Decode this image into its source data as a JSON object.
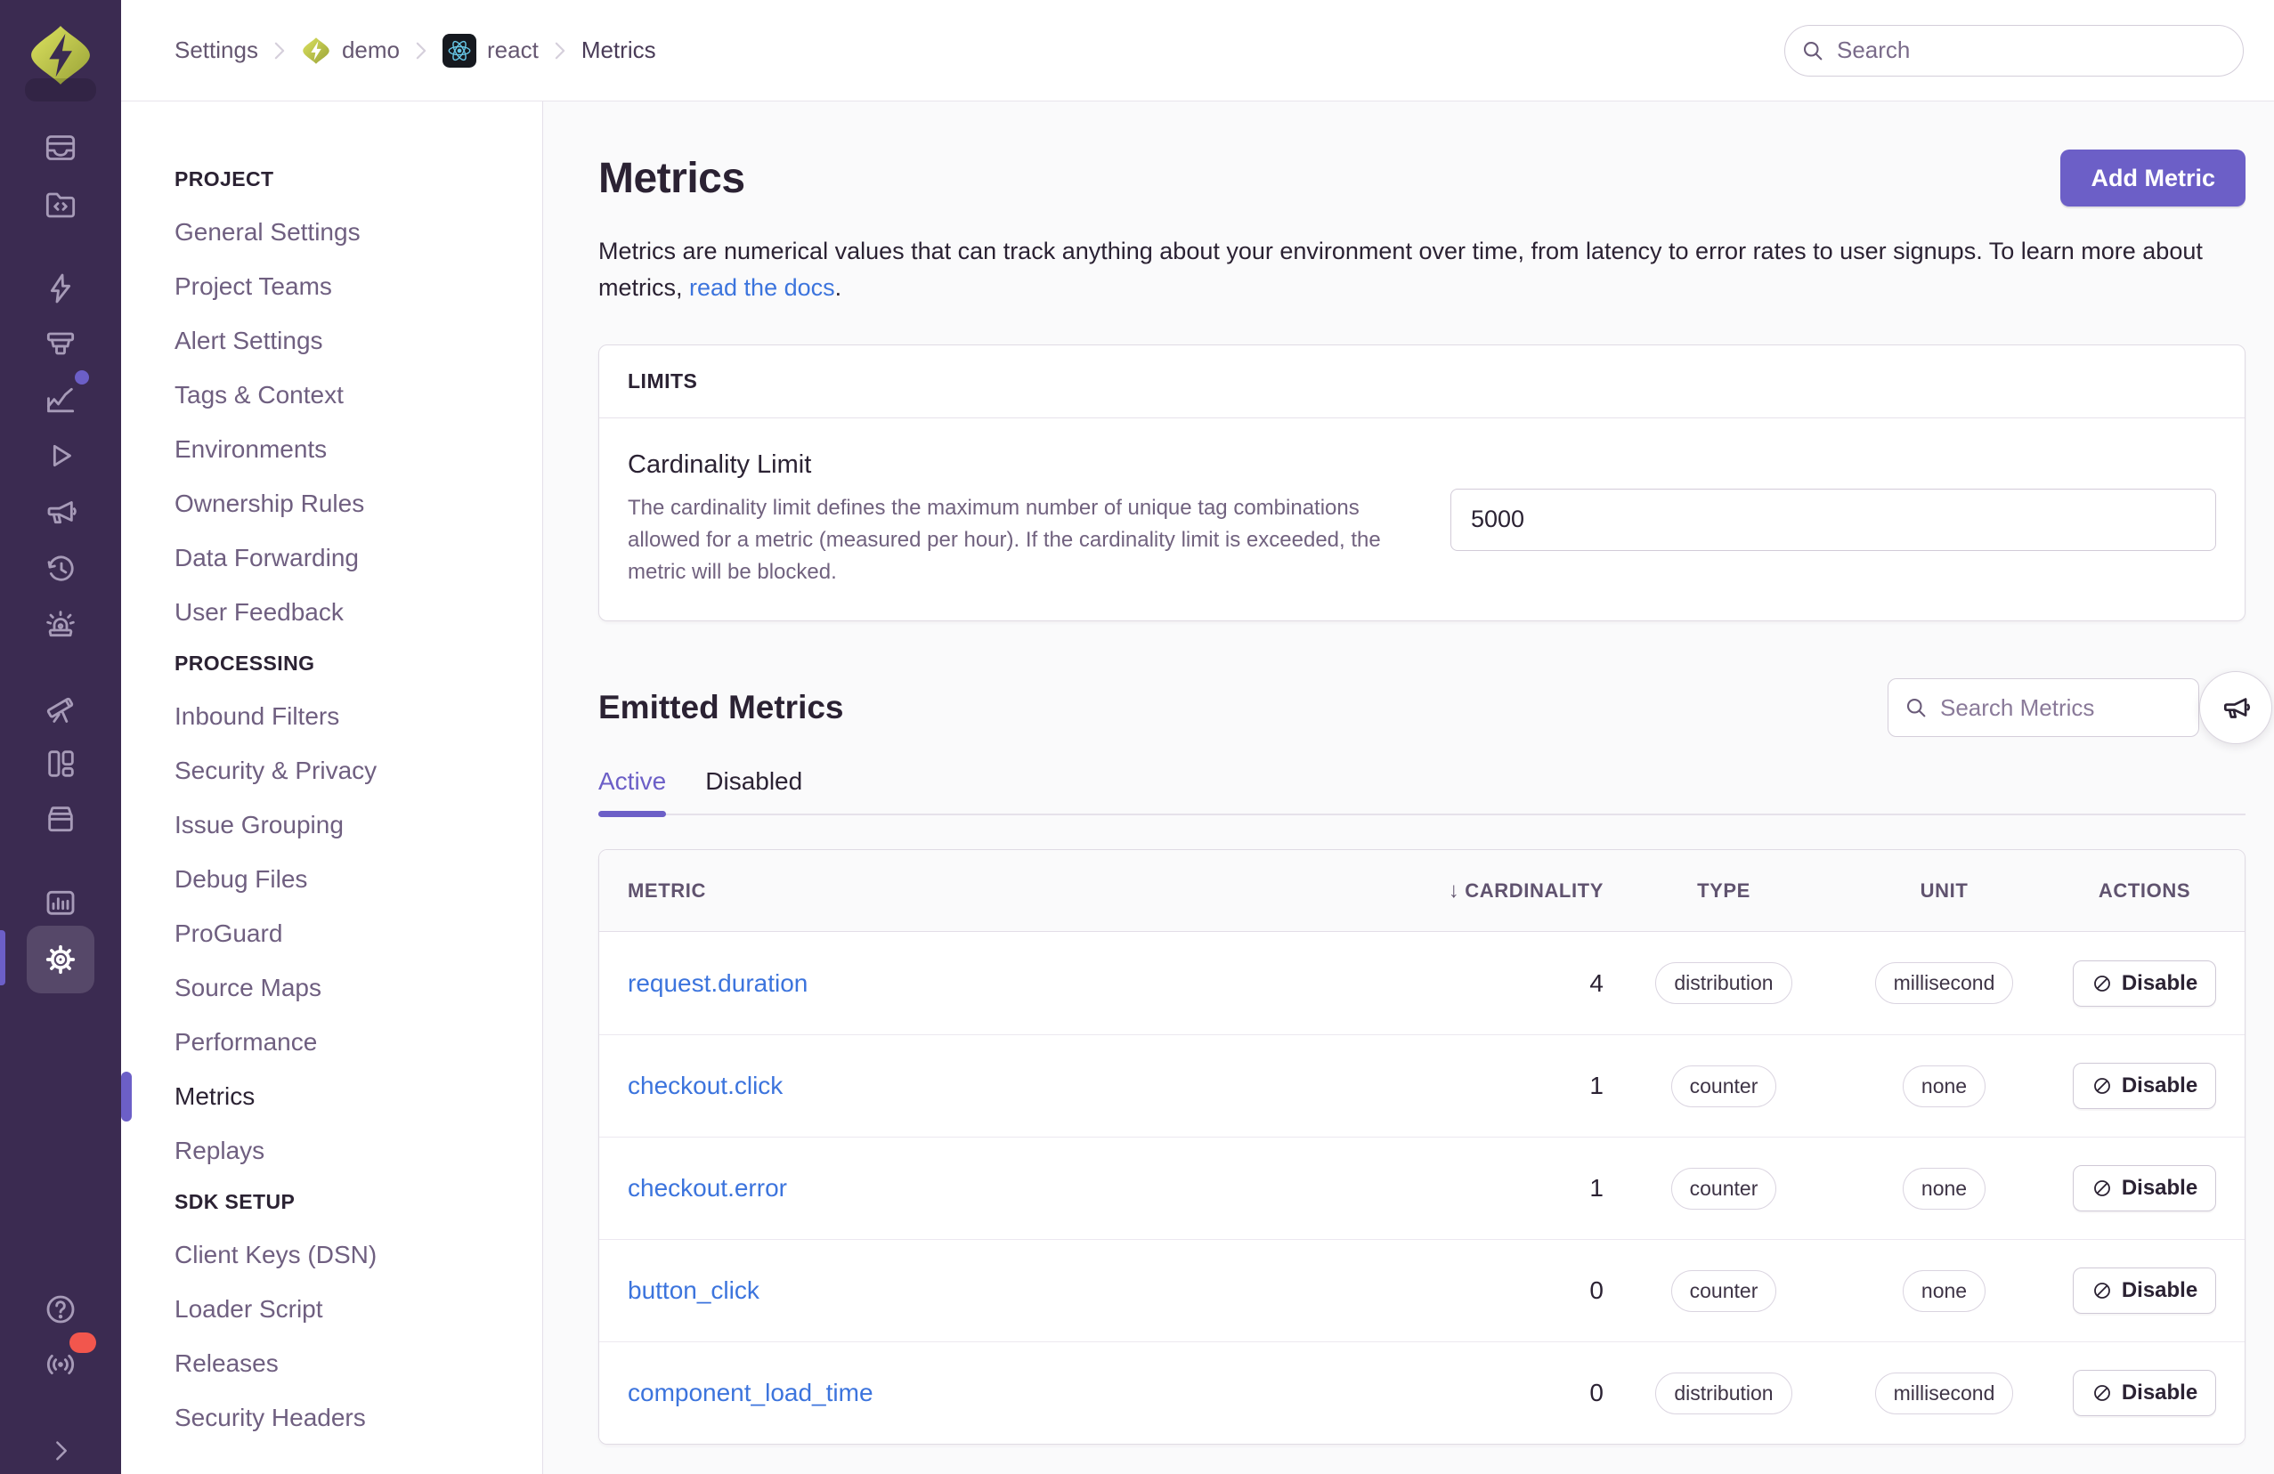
{
  "colors": {
    "accent_purple": "#6C5FC7",
    "rail_background": "#3B2B51",
    "link_blue": "#3C74DD",
    "heading_text": "#2B2233",
    "muted_text": "#71627F",
    "alert_red": "#F2564D",
    "brand_lime": "#C9D35A"
  },
  "rail": {
    "icons": [
      "issues",
      "projects",
      "performance",
      "explore",
      "insights",
      "replays",
      "feedback",
      "crons",
      "alerts",
      "discover",
      "dashboards",
      "releases",
      "stats",
      "settings",
      "help",
      "whats-new",
      "collapse-sidebar"
    ],
    "active_icon": "settings",
    "insights_badge": true,
    "whats_new_badge": true
  },
  "topbar": {
    "breadcrumb": [
      {
        "label": "Settings"
      },
      {
        "label": "demo",
        "icon": "sentry-diamond"
      },
      {
        "label": "react",
        "icon": "react-logo"
      },
      {
        "label": "Metrics"
      }
    ],
    "search_placeholder": "Search"
  },
  "sidebar": {
    "active_item": "Metrics",
    "sections": [
      {
        "title": "PROJECT",
        "items": [
          "General Settings",
          "Project Teams",
          "Alert Settings",
          "Tags & Context",
          "Environments",
          "Ownership Rules",
          "Data Forwarding",
          "User Feedback"
        ]
      },
      {
        "title": "PROCESSING",
        "items": [
          "Inbound Filters",
          "Security & Privacy",
          "Issue Grouping",
          "Debug Files",
          "ProGuard",
          "Source Maps",
          "Performance",
          "Metrics",
          "Replays"
        ]
      },
      {
        "title": "SDK SETUP",
        "items": [
          "Client Keys (DSN)",
          "Loader Script",
          "Releases",
          "Security Headers"
        ]
      }
    ]
  },
  "main": {
    "title": "Metrics",
    "add_button": "Add Metric",
    "description": {
      "before": "Metrics are numerical values that can track anything about your environment over time, from latency to error rates to user signups. To learn more about metrics, ",
      "link": "read the docs",
      "after": "."
    },
    "limits": {
      "title": "LIMITS",
      "field_label": "Cardinality Limit",
      "field_help": "The cardinality limit defines the maximum number of unique tag combinations allowed for a metric (measured per hour). If the cardinality limit is exceeded, the metric will be blocked.",
      "input_value": "5000"
    },
    "emitted": {
      "title": "Emitted Metrics",
      "search_placeholder": "Search Metrics",
      "tabs": [
        {
          "label": "Active",
          "active": true
        },
        {
          "label": "Disabled",
          "active": false
        }
      ]
    },
    "table": {
      "columns": [
        "METRIC",
        "CARDINALITY",
        "TYPE",
        "UNIT",
        "ACTIONS"
      ],
      "sort_column": "CARDINALITY",
      "sort_indicator": "↓",
      "rows": [
        {
          "metric": "request.duration",
          "cardinality": "4",
          "type": "distribution",
          "unit": "millisecond",
          "action": "Disable"
        },
        {
          "metric": "checkout.click",
          "cardinality": "1",
          "type": "counter",
          "unit": "none",
          "action": "Disable"
        },
        {
          "metric": "checkout.error",
          "cardinality": "1",
          "type": "counter",
          "unit": "none",
          "action": "Disable"
        },
        {
          "metric": "button_click",
          "cardinality": "0",
          "type": "counter",
          "unit": "none",
          "action": "Disable"
        },
        {
          "metric": "component_load_time",
          "cardinality": "0",
          "type": "distribution",
          "unit": "millisecond",
          "action": "Disable"
        }
      ]
    }
  }
}
